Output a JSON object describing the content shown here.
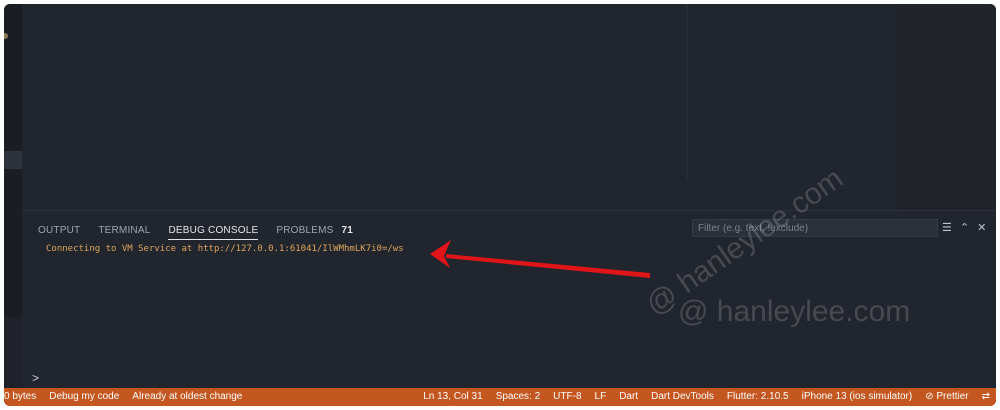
{
  "panel": {
    "tabs": [
      {
        "label": "OUTPUT"
      },
      {
        "label": "TERMINAL"
      },
      {
        "label": "DEBUG CONSOLE"
      },
      {
        "label": "PROBLEMS"
      }
    ],
    "problems_count": "71",
    "filter_placeholder": "Filter (e.g. text, !exclude)",
    "console_line": "Connecting to VM Service at http://127.0.0.1:61041/IlWMhmLK7i0=/ws",
    "prompt": ">"
  },
  "statusbar": {
    "left": [
      "0 bytes",
      "Debug my code",
      "Already at oldest change"
    ],
    "right": [
      "Ln 13, Col 31",
      "Spaces: 2",
      "UTF-8",
      "LF",
      "Dart",
      "Dart DevTools",
      "Flutter: 2.10.5",
      "iPhone 13 (ios simulator)",
      "⊘ Prettier"
    ]
  },
  "watermarks": [
    "@ hanleylee.com",
    "@ hanleylee.com"
  ],
  "colors": {
    "statusbar": "#c4561f",
    "console_text": "#e0a45a",
    "arrow": "#e0151a"
  }
}
